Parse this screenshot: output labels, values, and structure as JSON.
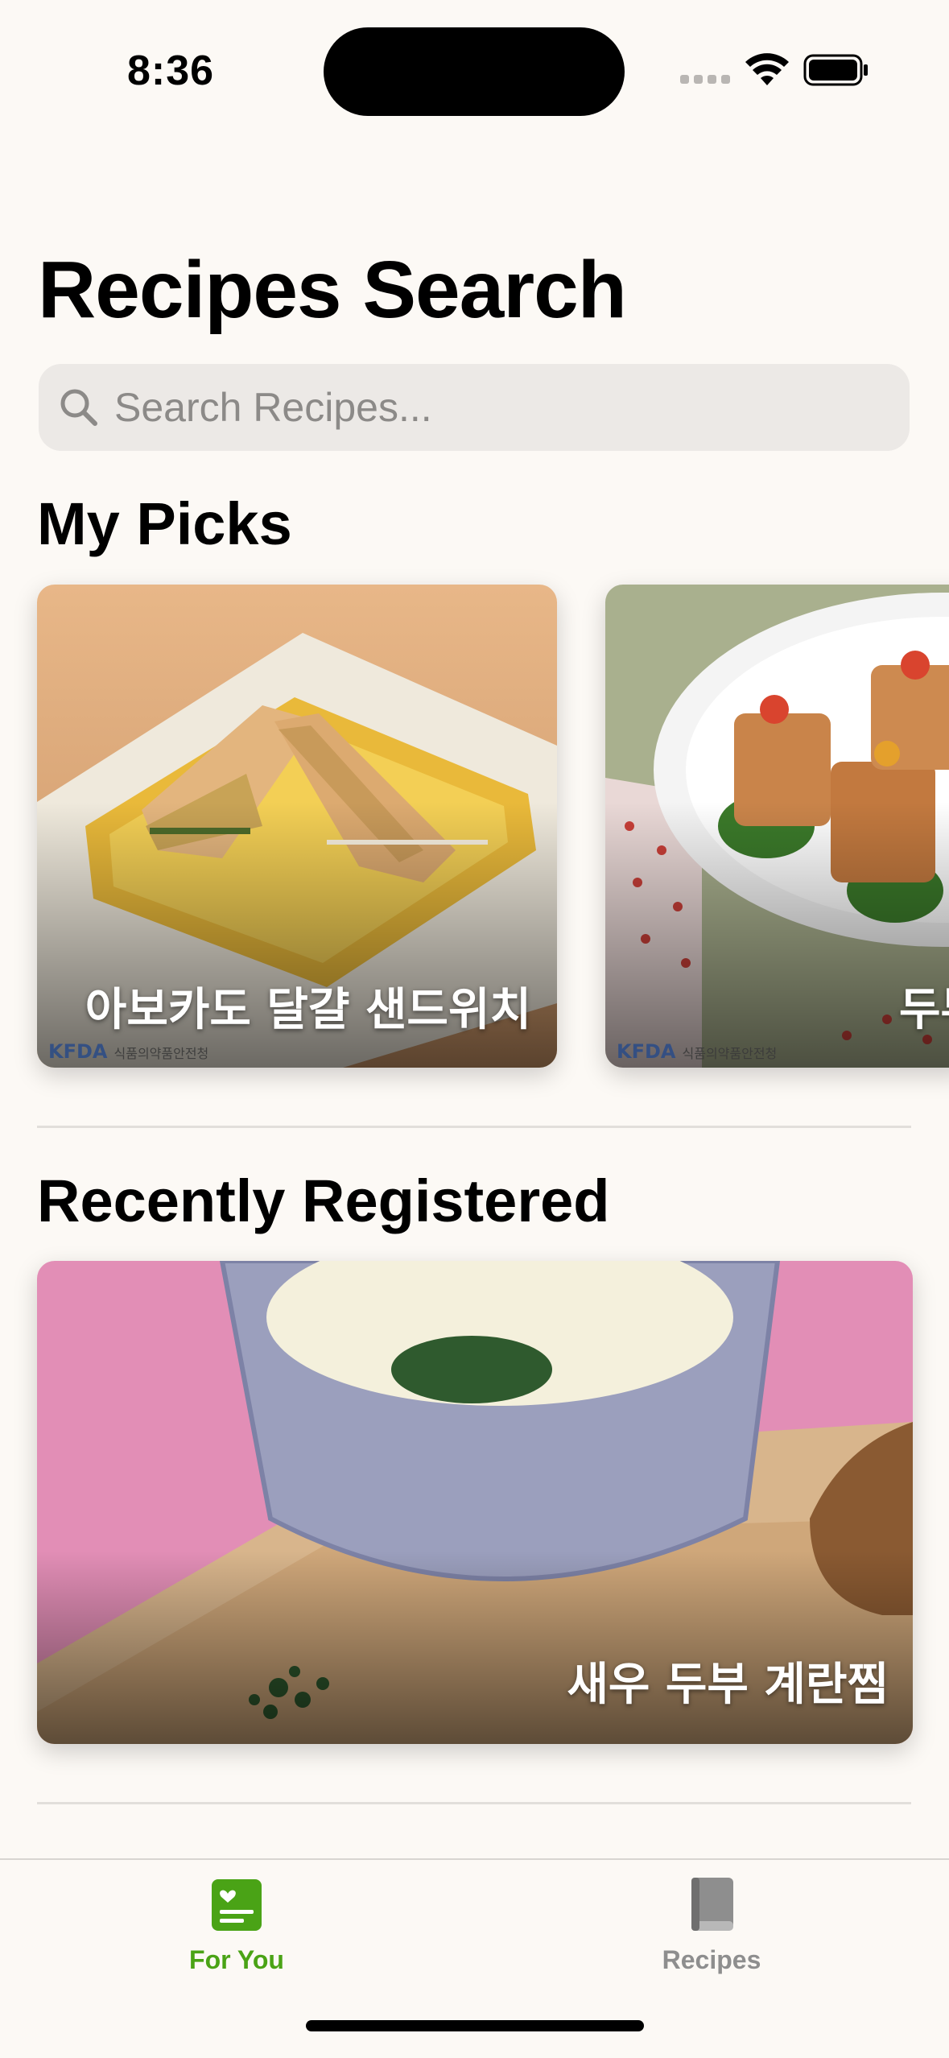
{
  "status_bar": {
    "time": "8:36"
  },
  "header": {
    "title": "Recipes Search"
  },
  "search": {
    "placeholder": "Search Recipes..."
  },
  "my_picks": {
    "title": "My Picks",
    "cards": [
      {
        "label": "아보카도 달걀 샌드위치",
        "watermark": "KFDA",
        "watermark_sub": "식품의약품안전청"
      },
      {
        "label": "두부",
        "watermark": "KFDA",
        "watermark_sub": "식품의약품안전청"
      }
    ]
  },
  "recently_registered": {
    "title": "Recently Registered",
    "cards": [
      {
        "label": "새우 두부 계란찜"
      }
    ]
  },
  "tab_bar": {
    "tabs": [
      {
        "label": "For You",
        "icon": "heart-list-icon",
        "active": true
      },
      {
        "label": "Recipes",
        "icon": "book-icon",
        "active": false
      }
    ]
  },
  "colors": {
    "background": "#fcf9f5",
    "accent": "#4aa316",
    "inactive": "#8e8e8e"
  }
}
